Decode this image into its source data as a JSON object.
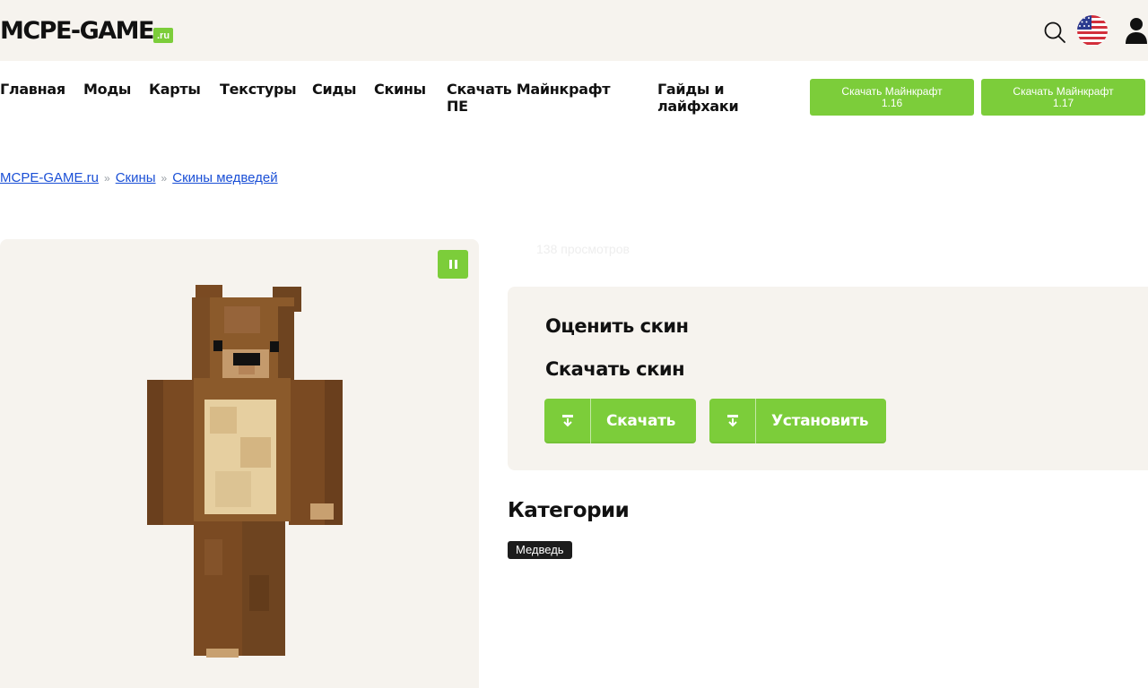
{
  "header": {
    "logo_text": "MCPE-GAME",
    "logo_suffix": ".ru",
    "icons": [
      "search-icon",
      "us-flag-icon",
      "user-icon"
    ]
  },
  "nav": {
    "items": [
      {
        "label": "Главная"
      },
      {
        "label": "Моды"
      },
      {
        "label": "Карты"
      },
      {
        "label": "Текстуры"
      },
      {
        "label": "Сиды"
      },
      {
        "label": "Скины"
      },
      {
        "label": "Скачать Майнкрафт ПЕ"
      },
      {
        "label": "Гайды и лайфхаки"
      }
    ],
    "buttons": [
      {
        "line1": "Скачать Майнкрафт",
        "line2": "1.16"
      },
      {
        "line1": "Скачать Майнкрафт",
        "line2": "1.17"
      }
    ]
  },
  "breadcrumb": {
    "items": [
      "MCPE-GAME.ru",
      "Скины",
      "Скины медведей"
    ],
    "separator": "»"
  },
  "skin": {
    "views": "138 просмотров",
    "pause_icon": "pause-icon"
  },
  "rate": {
    "rate_title": "Оценить скин",
    "download_title": "Скачать скин",
    "download_button": "Скачать",
    "install_button": "Установить"
  },
  "categories": {
    "title": "Категории",
    "tags": [
      "Медведь"
    ]
  },
  "colors": {
    "accent_green": "#7ccd3a",
    "panel_bg": "#f6f3ee",
    "link_blue": "#1a4fd6",
    "tag_bg": "#1c1c1c"
  }
}
